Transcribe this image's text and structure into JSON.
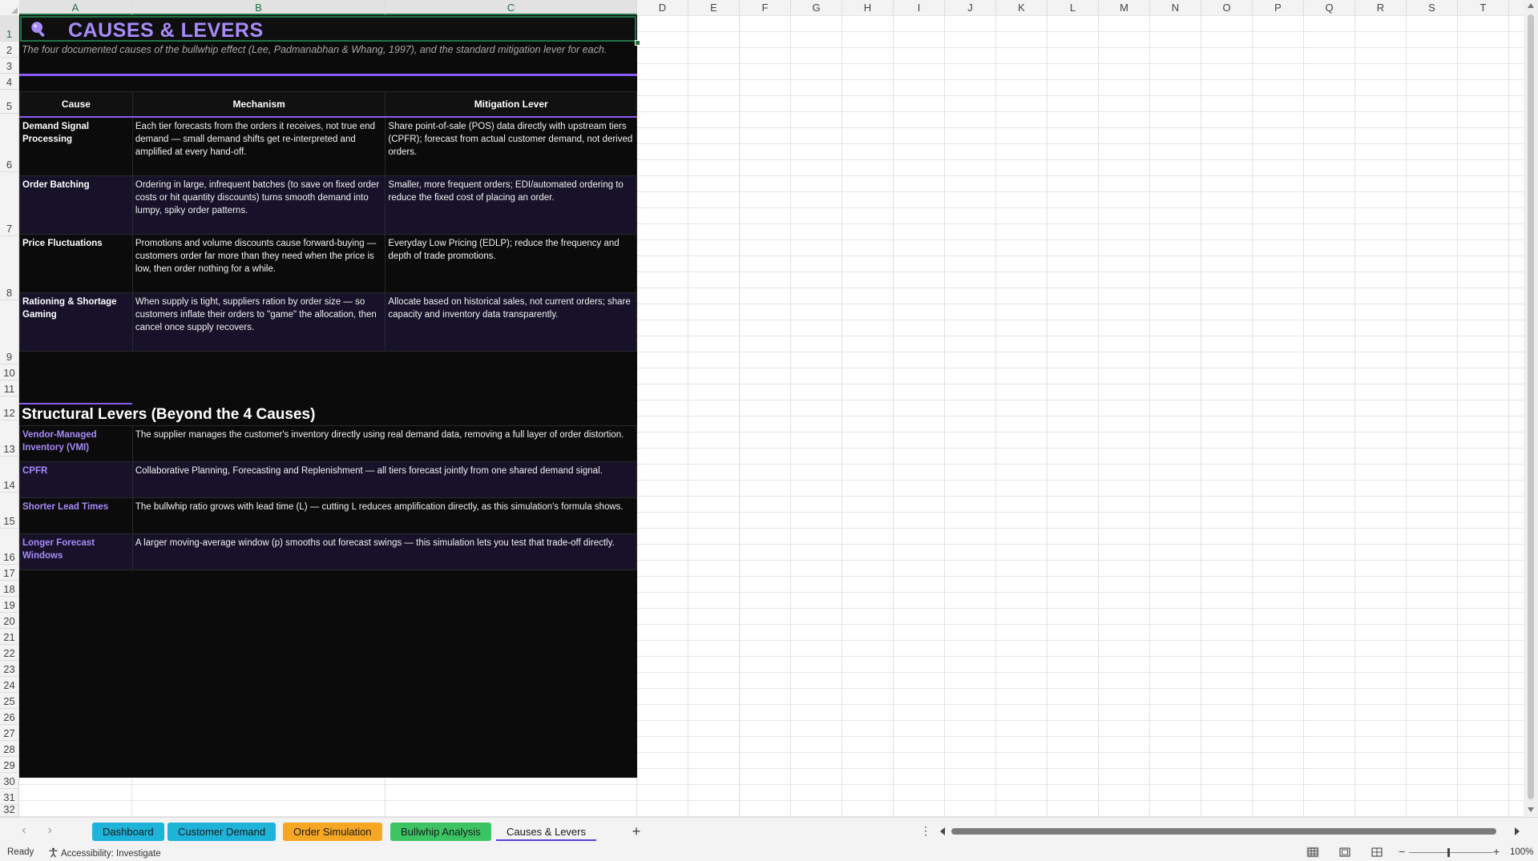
{
  "columns": [
    "A",
    "B",
    "C",
    "D",
    "E",
    "F",
    "G",
    "H",
    "I",
    "J",
    "K",
    "L",
    "M",
    "N",
    "O",
    "P",
    "Q",
    "R",
    "S",
    "T"
  ],
  "rows": [
    "1",
    "2",
    "3",
    "4",
    "5",
    "6",
    "7",
    "8",
    "9",
    "10",
    "11",
    "12",
    "13",
    "14",
    "15",
    "16",
    "17",
    "18",
    "19",
    "20",
    "21",
    "22",
    "23",
    "24",
    "25",
    "26",
    "27",
    "28",
    "29",
    "30",
    "31",
    "32"
  ],
  "sheet": {
    "title": "CAUSES & LEVERS",
    "subtitle": "The four documented causes of the bullwhip effect (Lee, Padmanabhan & Whang, 1997), and the standard mitigation lever for each.",
    "causes_table": {
      "headers": [
        "Cause",
        "Mechanism",
        "Mitigation Lever"
      ],
      "rows": [
        {
          "cause": "Demand Signal Processing",
          "mechanism": "Each tier forecasts from the orders it receives, not true end demand — small demand shifts get re-interpreted and amplified at every hand-off.",
          "lever": "Share point-of-sale (POS) data directly with upstream tiers (CPFR); forecast from actual customer demand, not derived orders."
        },
        {
          "cause": "Order Batching",
          "mechanism": "Ordering in large, infrequent batches (to save on fixed order costs or hit quantity discounts) turns smooth demand into lumpy, spiky order patterns.",
          "lever": "Smaller, more frequent orders; EDI/automated ordering to reduce the fixed cost of placing an order."
        },
        {
          "cause": "Price Fluctuations",
          "mechanism": "Promotions and volume discounts cause forward-buying — customers order far more than they need when the price is low, then order nothing for a while.",
          "lever": "Everyday Low Pricing (EDLP); reduce the frequency and depth of trade promotions."
        },
        {
          "cause": "Rationing & Shortage Gaming",
          "mechanism": "When supply is tight, suppliers ration by order size — so customers inflate their orders to \"game\" the allocation, then cancel once supply recovers.",
          "lever": "Allocate based on historical sales, not current orders; share capacity and inventory data transparently."
        }
      ]
    },
    "levers_section": {
      "title": "Structural Levers (Beyond the 4 Causes)",
      "items": [
        {
          "name": "Vendor-Managed Inventory (VMI)",
          "desc": "The supplier manages the customer's inventory directly using real demand data, removing a full layer of order distortion."
        },
        {
          "name": "CPFR",
          "desc": "Collaborative Planning, Forecasting and Replenishment — all tiers forecast jointly from one shared demand signal."
        },
        {
          "name": "Shorter Lead Times",
          "desc": "The bullwhip ratio grows with lead time (L) — cutting L reduces amplification directly, as this simulation's formula shows."
        },
        {
          "name": "Longer Forecast Windows",
          "desc": "A larger moving-average window (p) smooths out forecast swings — this simulation lets you test that trade-off directly."
        }
      ]
    }
  },
  "tabs": [
    {
      "label": "Dashboard",
      "color": "#1eb3d8",
      "active": false
    },
    {
      "label": "Customer Demand",
      "color": "#1eb3d8",
      "active": false
    },
    {
      "label": "Order Simulation",
      "color": "#f5a623",
      "active": false
    },
    {
      "label": "Bullwhip Analysis",
      "color": "#3cc464",
      "active": false
    },
    {
      "label": "Causes & Levers",
      "color": "#f3f3f3",
      "active": true
    }
  ],
  "status": {
    "ready": "Ready",
    "accessibility": "Accessibility: Investigate",
    "zoom": "100%"
  },
  "colors": {
    "accent_purple": "#a78bfa",
    "rule_purple": "#8b5cf6",
    "excel_green": "#217346"
  }
}
